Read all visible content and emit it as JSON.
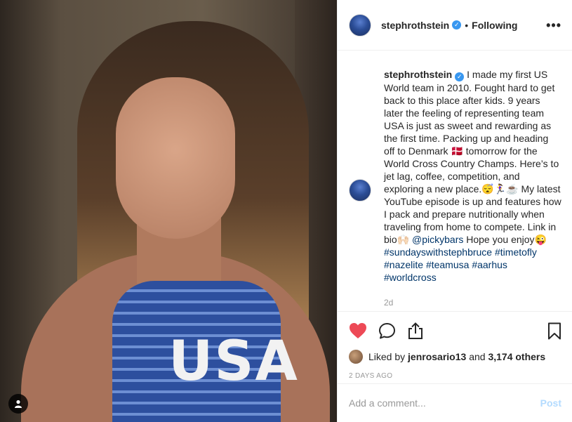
{
  "header": {
    "username": "stephrothstein",
    "separator": "•",
    "follow_status": "Following",
    "more_label": "•••"
  },
  "caption": {
    "username": "stephrothstein",
    "text_parts": [
      " I made my first US World team in 2010. Fought hard to get back to this place after kids. 9 years later the feeling of representing team USA is just as sweet and rewarding as the first time. Packing up and heading off to Denmark 🇩🇰 tomorrow for the World Cross Country Champs. Here’s to jet lag, coffee, competition, and exploring a new place.😴🏃‍♀️☕ My latest YouTube episode is up and features how I pack and prepare nutritionally when traveling from home to compete. Link in bio🙌🏻 ",
      "@pickybars",
      " Hope you enjoy😜 "
    ],
    "hashtags": [
      "#sundayswithstephbruce",
      "#timetofly",
      "#nazelite",
      "#teamusa",
      "#aarhus",
      "#worldcross"
    ],
    "age": "2d"
  },
  "photo": {
    "shirt_text": "USA"
  },
  "actions": {
    "liked_by_prefix": "Liked by",
    "liked_by_user": "jenrosario13",
    "and": "and",
    "others": "3,174 others",
    "timestamp": "2 DAYS AGO"
  },
  "comment_box": {
    "placeholder": "Add a comment...",
    "post_label": "Post"
  },
  "colors": {
    "heart": "#ed4956",
    "verified": "#3897f0",
    "link": "#003569",
    "post_disabled": "#b3dbff"
  }
}
